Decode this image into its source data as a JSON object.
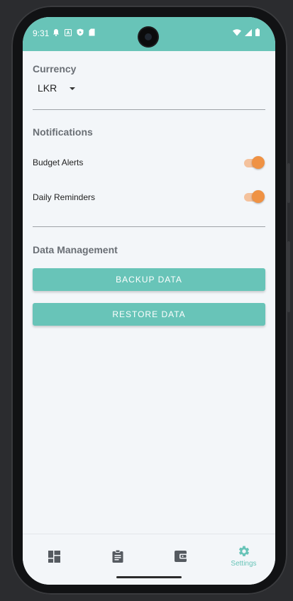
{
  "status_bar": {
    "time": "9:31",
    "icons_left": [
      "notification-bell-icon",
      "app-a-icon",
      "shield-play-icon",
      "sd-card-icon"
    ],
    "icons_right": [
      "wifi-icon",
      "signal-icon",
      "battery-icon"
    ],
    "bg_color": "#68c4b8"
  },
  "currency": {
    "title": "Currency",
    "selected": "LKR"
  },
  "notifications": {
    "title": "Notifications",
    "items": [
      {
        "label": "Budget Alerts",
        "enabled": true
      },
      {
        "label": "Daily Reminders",
        "enabled": true
      }
    ]
  },
  "data_management": {
    "title": "Data Management",
    "backup_label": "BACKUP DATA",
    "restore_label": "RESTORE DATA"
  },
  "bottom_nav": {
    "items": [
      {
        "icon": "dashboard-icon",
        "label": ""
      },
      {
        "icon": "clipboard-icon",
        "label": ""
      },
      {
        "icon": "wallet-icon",
        "label": ""
      },
      {
        "icon": "gear-icon",
        "label": "Settings",
        "active": true
      }
    ]
  },
  "colors": {
    "accent": "#68c4b8",
    "switch_thumb": "#ef9244",
    "switch_track": "#f4c29d"
  }
}
